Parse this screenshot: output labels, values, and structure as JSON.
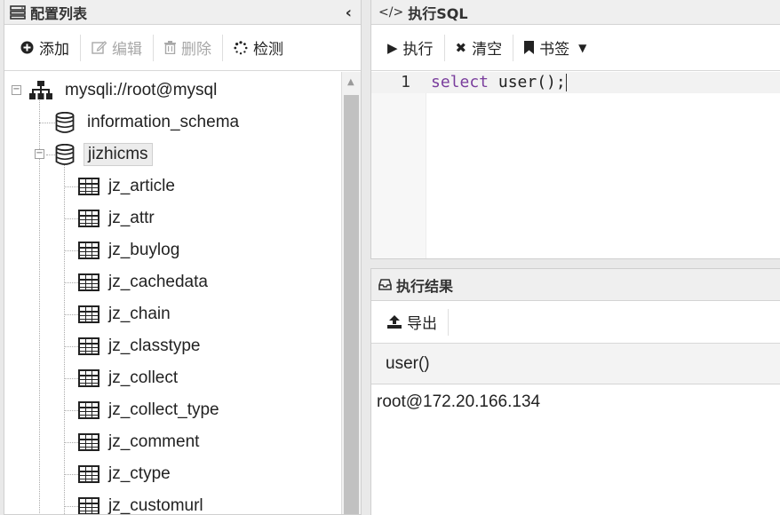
{
  "left_panel": {
    "title": "配置列表",
    "collapse_glyph": "‹",
    "toolbar": [
      {
        "label": "添加",
        "icon": "plus-circle-icon",
        "enabled": true
      },
      {
        "label": "编辑",
        "icon": "edit-icon",
        "enabled": false
      },
      {
        "label": "删除",
        "icon": "trash-icon",
        "enabled": false
      },
      {
        "label": "检测",
        "icon": "spinner-icon",
        "enabled": true
      }
    ],
    "tree": {
      "connection": "mysqli://root@mysql",
      "databases": [
        {
          "name": "information_schema"
        },
        {
          "name": "jizhicms",
          "selected": true
        }
      ],
      "tables": [
        "jz_article",
        "jz_attr",
        "jz_buylog",
        "jz_cachedata",
        "jz_chain",
        "jz_classtype",
        "jz_collect",
        "jz_collect_type",
        "jz_comment",
        "jz_ctype",
        "jz_customurl"
      ]
    }
  },
  "sql_panel": {
    "title": "执行SQL",
    "toolbar": {
      "run": "执行",
      "clear": "清空",
      "bookmark": "书签"
    },
    "editor": {
      "line_number": "1",
      "keyword": "select",
      "rest": " user();"
    }
  },
  "result_panel": {
    "title": "执行结果",
    "export": "导出",
    "columns": [
      "user()"
    ],
    "rows": [
      [
        "root@172.20.166.134"
      ]
    ]
  },
  "colors": {
    "keyword": "#7a3e9d",
    "header_bg": "#efefef"
  }
}
